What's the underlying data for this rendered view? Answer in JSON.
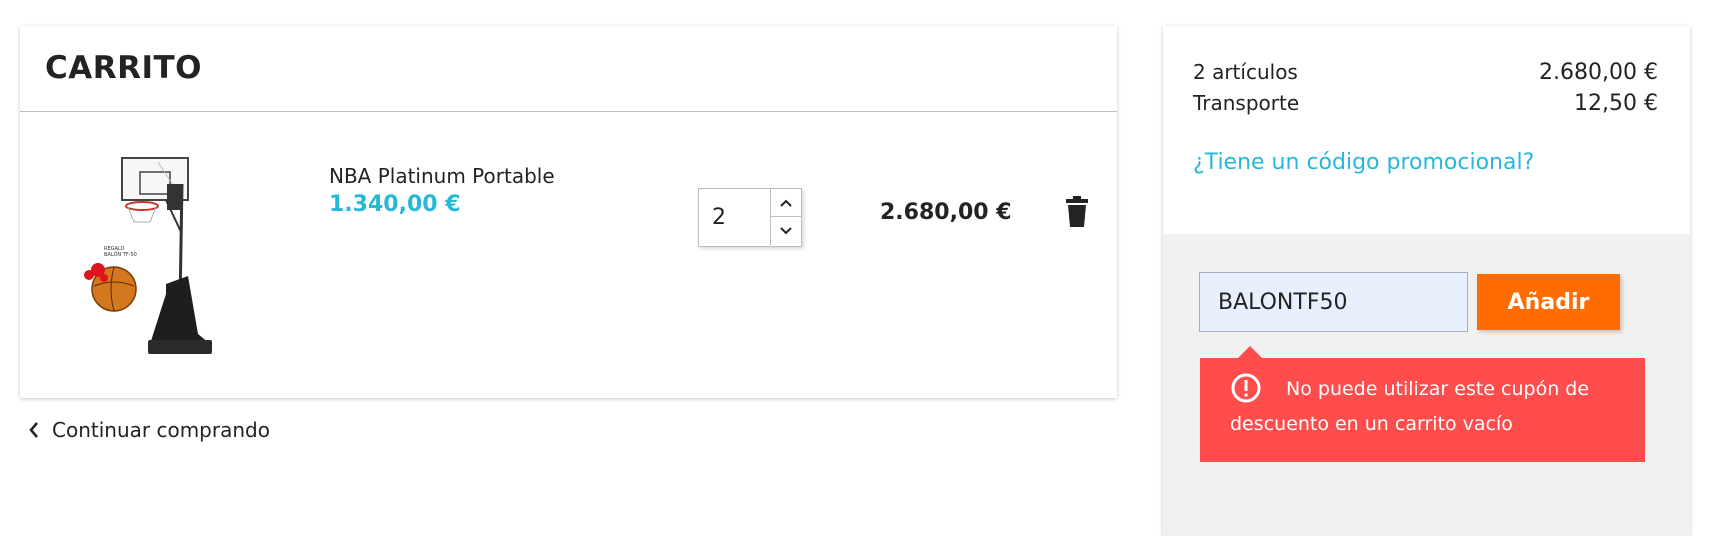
{
  "cart": {
    "title": "CARRITO",
    "item": {
      "name": "NBA Platinum Portable",
      "unit_price": "1.340,00 €",
      "quantity": "2",
      "line_total": "2.680,00 €",
      "image_icon": "basketball-hoop-image"
    },
    "continue_label": "Continuar comprando"
  },
  "summary": {
    "items_label": "2 artículos",
    "items_value": "2.680,00 €",
    "shipping_label": "Transporte",
    "shipping_value": "12,50 €",
    "promo_link": "¿Tiene un código promocional?",
    "promo_code_value": "BALONTF50",
    "add_button": "Añadir",
    "error_message": "No puede utilizar este cupón de descuento en un carrito vacío"
  },
  "colors": {
    "accent_link": "#25b9d7",
    "button_orange": "#ff6c00",
    "error_red": "#ff4c4c"
  }
}
